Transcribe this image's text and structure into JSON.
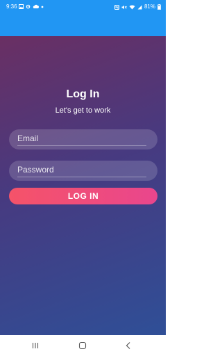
{
  "status_bar": {
    "time": "9:36",
    "battery": "81%",
    "left_icons": [
      "photo-icon",
      "gear-icon",
      "cloud-icon",
      "dot-icon"
    ],
    "right_icons": [
      "nfc-icon",
      "mute-icon",
      "wifi-icon",
      "signal-icon",
      "battery-icon"
    ]
  },
  "colors": {
    "accent": "#2196F3",
    "gradient_top": "#6a2f63",
    "gradient_bottom": "#2f4f97",
    "button_start": "#f55369",
    "button_end": "#e9468d"
  },
  "login": {
    "title": "Log In",
    "subtitle": "Let's get to work",
    "email_placeholder": "Email",
    "email_value": "",
    "password_placeholder": "Password",
    "password_value": "",
    "button_label": "LOG IN"
  },
  "nav_bar": {
    "icons": [
      "recents-icon",
      "home-icon",
      "back-icon"
    ]
  }
}
